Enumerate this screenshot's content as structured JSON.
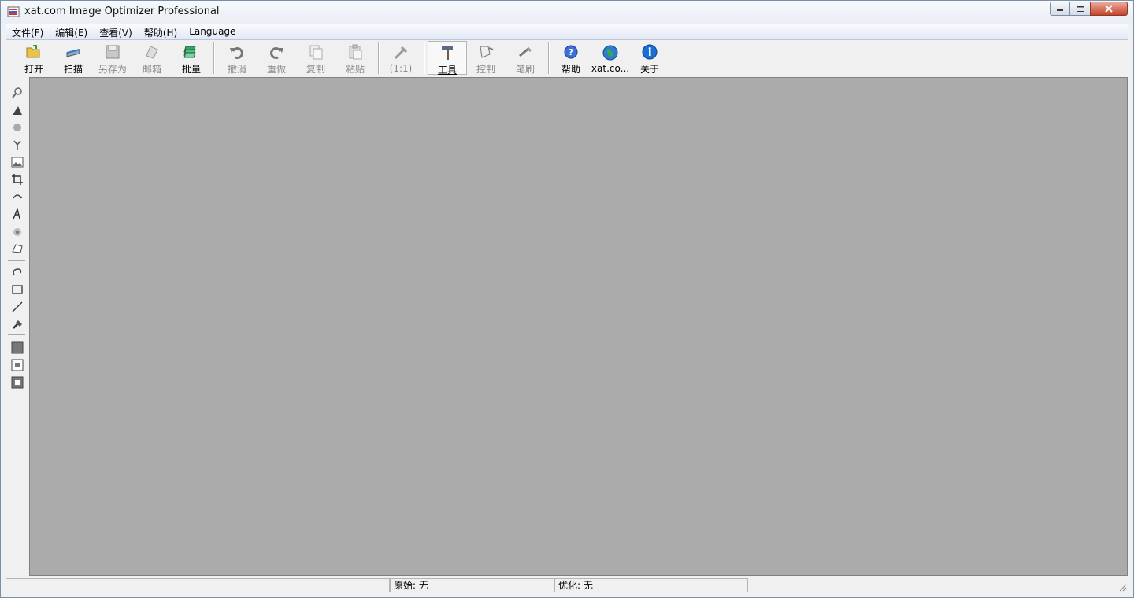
{
  "window": {
    "title": "xat.com  Image Optimizer Professional"
  },
  "menu": [
    {
      "label": "文件(F)"
    },
    {
      "label": "编辑(E)"
    },
    {
      "label": "查看(V)"
    },
    {
      "label": "帮助(H)"
    },
    {
      "label": "Language"
    }
  ],
  "toolbar": {
    "open": "打开",
    "scan": "扫描",
    "save_as": "另存为",
    "mail": "邮箱",
    "batch": "批量",
    "undo": "撤消",
    "redo": "重做",
    "copy": "复制",
    "paste": "粘贴",
    "zoom_1to1": "(1:1)",
    "tools": "工具",
    "control": "控制",
    "brush": "笔刷",
    "help": "帮助",
    "website": "xat.co...",
    "about": "关于"
  },
  "status": {
    "original": "原始: 无",
    "optimized": "优化: 无"
  },
  "colors": {
    "canvas": "#ababab",
    "accent_blue": "#1a6fd6",
    "close_red": "#c7432a"
  }
}
